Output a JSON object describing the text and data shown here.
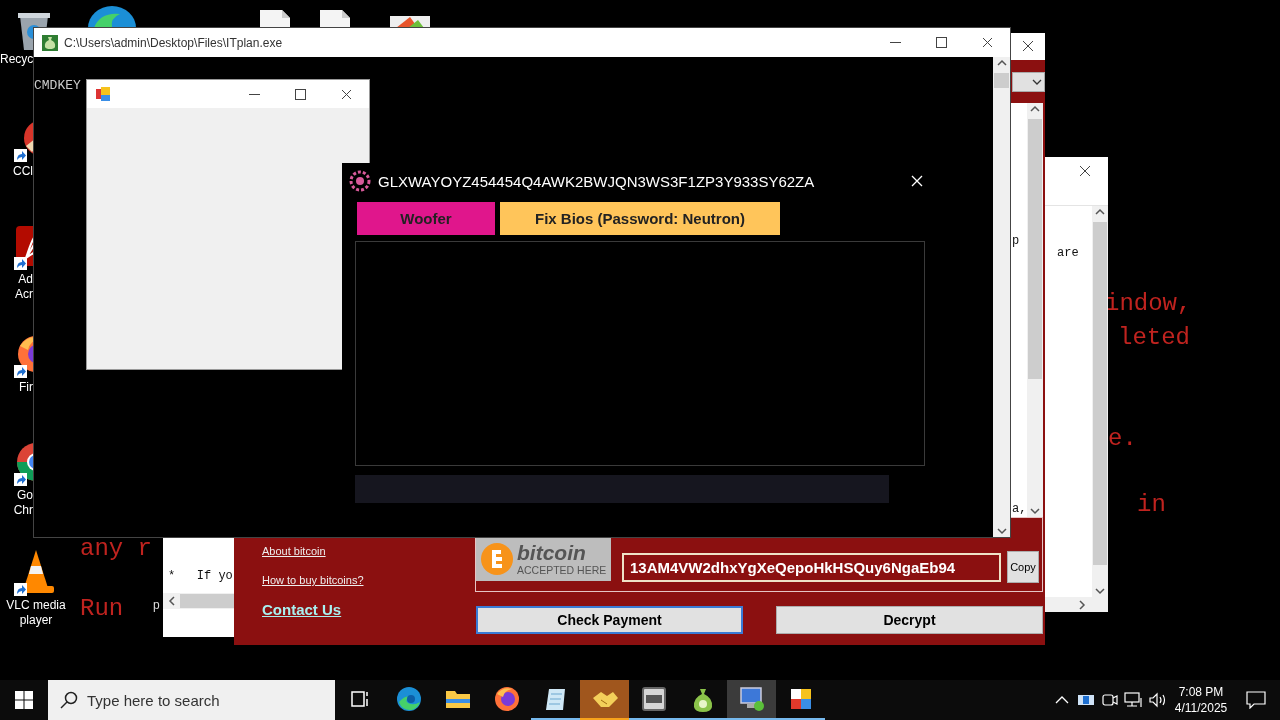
{
  "desktop_icons": [
    {
      "kind": "recycle",
      "lines": [
        "Recyc"
      ]
    },
    {
      "kind": "cleaner",
      "lines": [
        "CCl"
      ]
    },
    {
      "kind": "acrobat",
      "lines": [
        "Ad",
        "Acr"
      ]
    },
    {
      "kind": "firefox",
      "lines": [
        "Fir"
      ]
    },
    {
      "kind": "chrome",
      "lines": [
        "Go",
        "Chr"
      ]
    },
    {
      "kind": "vlc",
      "lines": [
        "VLC media",
        "player"
      ]
    }
  ],
  "background_text": [
    {
      "kind": "red",
      "text": "indow,"
    },
    {
      "kind": "red",
      "text": "leted"
    },
    {
      "kind": "red",
      "text": "e."
    },
    {
      "kind": "red",
      "text": "in"
    },
    {
      "kind": "red",
      "text": "any r"
    },
    {
      "kind": "red",
      "text": "Run"
    },
    {
      "kind": "plain",
      "text": "p"
    }
  ],
  "side_window": {
    "text": "are"
  },
  "ransom_window": {
    "side_text": [
      "p",
      "a,"
    ],
    "links": [
      "About bitcoin",
      "How to buy bitcoins?"
    ],
    "contact": "Contact Us",
    "logo_word": "bitcoin",
    "logo_caption": "ACCEPTED HERE",
    "address": "13AM4VW2dhxYgXeQepoHkHSQuy6NgaEb94",
    "copy_button": "Copy",
    "buttons": [
      {
        "label": "Check Payment",
        "focused": true
      },
      {
        "label": "Decrypt",
        "focused": false
      }
    ]
  },
  "note_window": {
    "line": "*   If yo"
  },
  "console_window": {
    "title": "C:\\Users\\admin\\Desktop\\Files\\ITplan.exe",
    "output": "CMDKEY"
  },
  "dialog": {
    "title": "GLXWAYOYZ454454Q4AWK2BWJQN3WS3F1ZP3Y933SY62ZA",
    "tabs": [
      {
        "label": "Woofer",
        "color": "#e0168c"
      },
      {
        "label": "Fix Bios (Password: Neutron)",
        "color": "#ffc55a"
      }
    ]
  },
  "taskbar": {
    "search_placeholder": "Type here to search",
    "apps": [
      {
        "kind": "taskview",
        "running": false,
        "selected": false,
        "flashing": false
      },
      {
        "kind": "edge",
        "running": false,
        "selected": false,
        "flashing": false
      },
      {
        "kind": "explorer",
        "running": false,
        "selected": false,
        "flashing": false
      },
      {
        "kind": "firefox",
        "running": false,
        "selected": false,
        "flashing": false
      },
      {
        "kind": "notepad",
        "running": true,
        "selected": false,
        "flashing": false
      },
      {
        "kind": "handshake",
        "running": true,
        "selected": false,
        "flashing": true
      },
      {
        "kind": "prx",
        "running": true,
        "selected": false,
        "flashing": false
      },
      {
        "kind": "moneybag",
        "running": true,
        "selected": false,
        "flashing": false
      },
      {
        "kind": "computer",
        "running": true,
        "selected": true,
        "flashing": false
      },
      {
        "kind": "paint",
        "running": true,
        "selected": false,
        "flashing": false
      }
    ],
    "time": "7:08 PM",
    "date": "4/11/2025"
  }
}
